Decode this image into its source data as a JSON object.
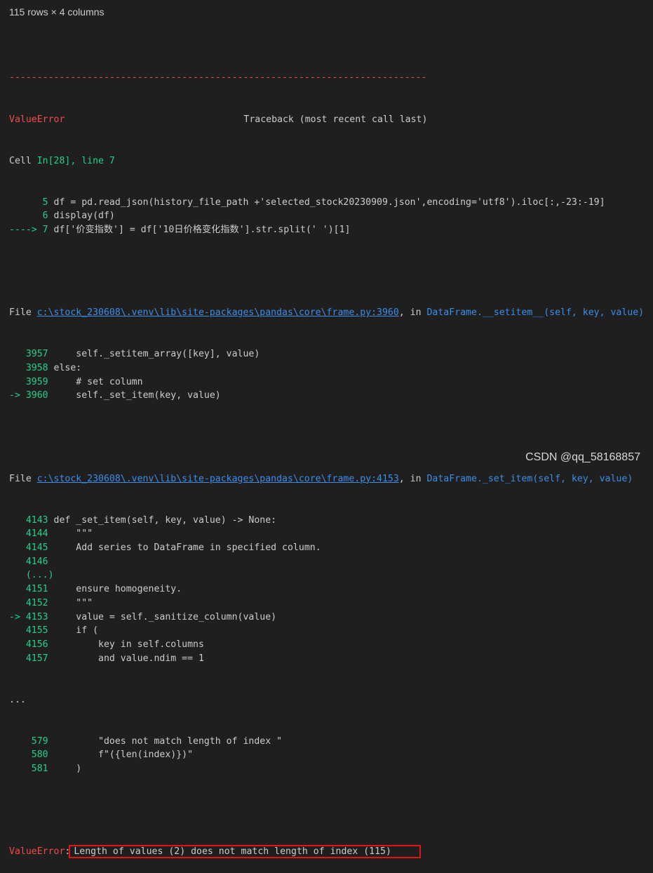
{
  "output_info": "115 rows × 4 columns",
  "traceback": {
    "dashes": "---------------------------------------------------------------------------",
    "error_type": "ValueError",
    "header_right": "Traceback (most recent call last)",
    "cell_label": "Cell ",
    "cell_ref": "In[28], line 7",
    "cell_lines": [
      {
        "marker": "      ",
        "no": "5",
        "code": " df = pd.read_json(history_file_path +'selected_stock20230909.json',encoding='utf8').iloc[:,-23:-19]"
      },
      {
        "marker": "      ",
        "no": "6",
        "code": " display(df)"
      },
      {
        "marker": "----> ",
        "no": "7",
        "code": " df['价变指数'] = df['10日价格变化指数'].str.split(' ')[1]"
      }
    ],
    "file1": {
      "prefix": "File ",
      "path": "c:\\stock_230608\\.venv\\lib\\site-packages\\pandas\\core\\frame.py:3960",
      "in": ", in ",
      "func": "DataFrame.__setitem__(self, key, value)",
      "lines": [
        {
          "marker": "   ",
          "no": "3957",
          "code": "     self._setitem_array([key], value)"
        },
        {
          "marker": "   ",
          "no": "3958",
          "code": " else:"
        },
        {
          "marker": "   ",
          "no": "3959",
          "code": "     # set column"
        },
        {
          "marker": "-> ",
          "no": "3960",
          "code": "     self._set_item(key, value)"
        }
      ]
    },
    "file2": {
      "prefix": "File ",
      "path": "c:\\stock_230608\\.venv\\lib\\site-packages\\pandas\\core\\frame.py:4153",
      "in": ", in ",
      "func": "DataFrame._set_item(self, key, value)",
      "lines": [
        {
          "marker": "   ",
          "no": "4143",
          "code": " def _set_item(self, key, value) -> None:"
        },
        {
          "marker": "   ",
          "no": "4144",
          "code": "     \"\"\""
        },
        {
          "marker": "   ",
          "no": "4145",
          "code": "     Add series to DataFrame in specified column."
        },
        {
          "marker": "   ",
          "no": "4146",
          "code": ""
        },
        {
          "marker": "   ",
          "no": "(...)",
          "code": ""
        },
        {
          "marker": "   ",
          "no": "4151",
          "code": "     ensure homogeneity."
        },
        {
          "marker": "   ",
          "no": "4152",
          "code": "     \"\"\""
        },
        {
          "marker": "-> ",
          "no": "4153",
          "code": "     value = self._sanitize_column(value)"
        },
        {
          "marker": "   ",
          "no": "4155",
          "code": "     if ("
        },
        {
          "marker": "   ",
          "no": "4156",
          "code": "         key in self.columns"
        },
        {
          "marker": "   ",
          "no": "4157",
          "code": "         and value.ndim == 1"
        }
      ]
    },
    "ellipsis": "...",
    "tail_lines": [
      {
        "marker": "    ",
        "no": "579",
        "code": "         \"does not match length of index \""
      },
      {
        "marker": "    ",
        "no": "580",
        "code": "         f\"({len(index)})\""
      },
      {
        "marker": "    ",
        "no": "581",
        "code": "     )"
      }
    ],
    "final_error_type": "ValueError",
    "final_colon": ":",
    "final_message": "Length of values (2) does not match length of index (115)"
  },
  "watermark": "CSDN @qq_58168857"
}
